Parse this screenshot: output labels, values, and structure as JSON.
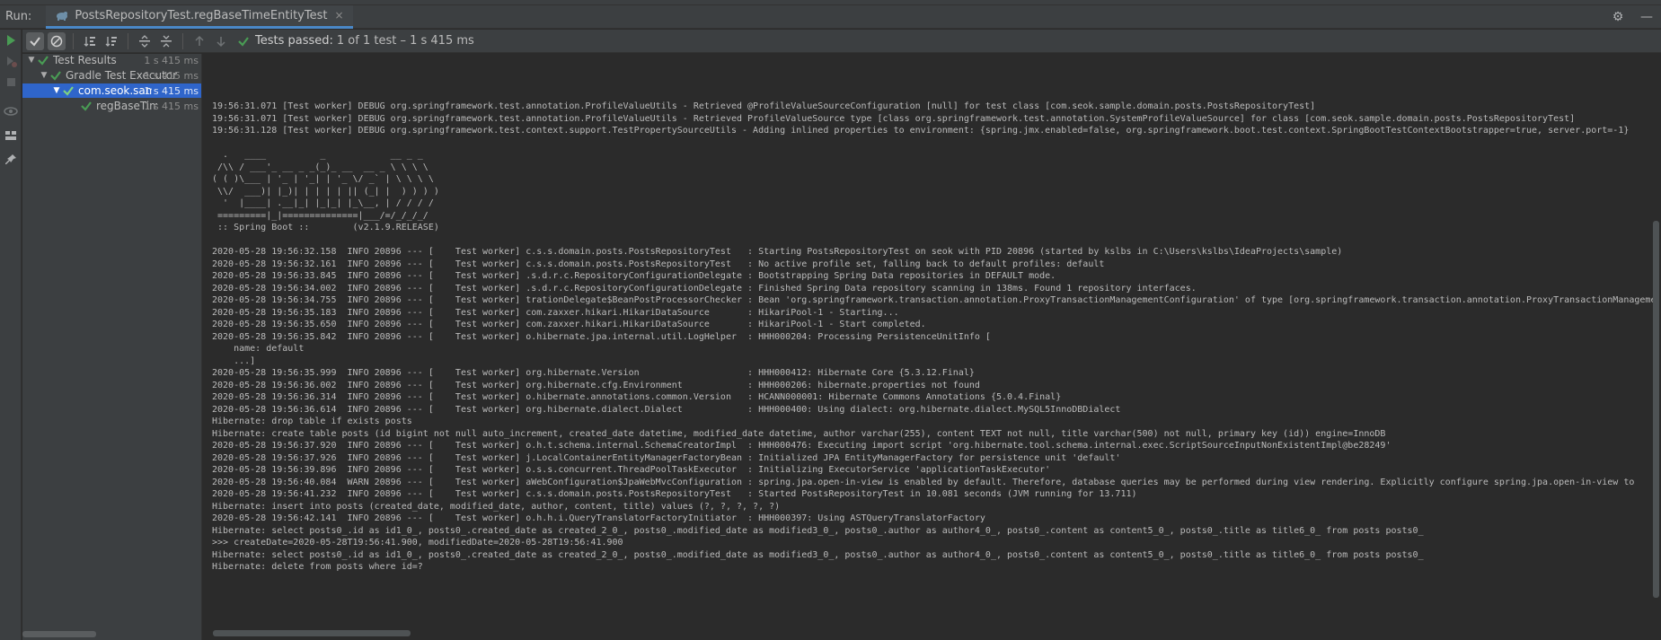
{
  "header": {
    "run_label": "Run:",
    "tab_title": "PostsRepositoryTest.regBaseTimeEntityTest",
    "close_glyph": "×",
    "settings_glyph": "⚙",
    "minimize_glyph": "—"
  },
  "toolbar": {
    "status_label": "Tests passed:",
    "status_summary": "1 of 1 test – 1 s 415 ms"
  },
  "tree": [
    {
      "label": "Test Results",
      "time": "1 s 415 ms"
    },
    {
      "label": "Gradle Test Executor",
      "time": "1 s 415 ms"
    },
    {
      "label": "com.seok.sample.",
      "time": "1 s 415 ms"
    },
    {
      "label": "regBaseTimeEn",
      "time": "1 s 415 ms"
    }
  ],
  "console": {
    "lines": [
      "19:56:31.071 [Test worker] DEBUG org.springframework.test.annotation.ProfileValueUtils - Retrieved @ProfileValueSourceConfiguration [null] for test class [com.seok.sample.domain.posts.PostsRepositoryTest]",
      "19:56:31.071 [Test worker] DEBUG org.springframework.test.annotation.ProfileValueUtils - Retrieved ProfileValueSource type [class org.springframework.test.annotation.SystemProfileValueSource] for class [com.seok.sample.domain.posts.PostsRepositoryTest]",
      "19:56:31.128 [Test worker] DEBUG org.springframework.test.context.support.TestPropertySourceUtils - Adding inlined properties to environment: {spring.jmx.enabled=false, org.springframework.boot.test.context.SpringBootTestContextBootstrapper=true, server.port=-1}",
      "",
      "  .   ____          _            __ _ _",
      " /\\\\ / ___'_ __ _ _(_)_ __  __ _ \\ \\ \\ \\",
      "( ( )\\___ | '_ | '_| | '_ \\/ _` | \\ \\ \\ \\",
      " \\\\/  ___)| |_)| | | | | || (_| |  ) ) ) )",
      "  '  |____| .__|_| |_|_| |_\\__, | / / / /",
      " =========|_|==============|___/=/_/_/_/",
      " :: Spring Boot ::        (v2.1.9.RELEASE)",
      "",
      "2020-05-28 19:56:32.158  INFO 20896 --- [    Test worker] c.s.s.domain.posts.PostsRepositoryTest   : Starting PostsRepositoryTest on seok with PID 20896 (started by kslbs in C:\\Users\\kslbs\\IdeaProjects\\sample)",
      "2020-05-28 19:56:32.161  INFO 20896 --- [    Test worker] c.s.s.domain.posts.PostsRepositoryTest   : No active profile set, falling back to default profiles: default",
      "2020-05-28 19:56:33.845  INFO 20896 --- [    Test worker] .s.d.r.c.RepositoryConfigurationDelegate : Bootstrapping Spring Data repositories in DEFAULT mode.",
      "2020-05-28 19:56:34.002  INFO 20896 --- [    Test worker] .s.d.r.c.RepositoryConfigurationDelegate : Finished Spring Data repository scanning in 138ms. Found 1 repository interfaces.",
      "2020-05-28 19:56:34.755  INFO 20896 --- [    Test worker] trationDelegate$BeanPostProcessorChecker : Bean 'org.springframework.transaction.annotation.ProxyTransactionManagementConfiguration' of type [org.springframework.transaction.annotation.ProxyTransactionManagementConfiguration",
      "2020-05-28 19:56:35.183  INFO 20896 --- [    Test worker] com.zaxxer.hikari.HikariDataSource       : HikariPool-1 - Starting...",
      "2020-05-28 19:56:35.650  INFO 20896 --- [    Test worker] com.zaxxer.hikari.HikariDataSource       : HikariPool-1 - Start completed.",
      "2020-05-28 19:56:35.842  INFO 20896 --- [    Test worker] o.hibernate.jpa.internal.util.LogHelper  : HHH000204: Processing PersistenceUnitInfo [",
      "    name: default",
      "    ...]",
      "2020-05-28 19:56:35.999  INFO 20896 --- [    Test worker] org.hibernate.Version                    : HHH000412: Hibernate Core {5.3.12.Final}",
      "2020-05-28 19:56:36.002  INFO 20896 --- [    Test worker] org.hibernate.cfg.Environment            : HHH000206: hibernate.properties not found",
      "2020-05-28 19:56:36.314  INFO 20896 --- [    Test worker] o.hibernate.annotations.common.Version   : HCANN000001: Hibernate Commons Annotations {5.0.4.Final}",
      "2020-05-28 19:56:36.614  INFO 20896 --- [    Test worker] org.hibernate.dialect.Dialect            : HHH000400: Using dialect: org.hibernate.dialect.MySQL5InnoDBDialect",
      "Hibernate: drop table if exists posts",
      "Hibernate: create table posts (id bigint not null auto_increment, created_date datetime, modified_date datetime, author varchar(255), content TEXT not null, title varchar(500) not null, primary key (id)) engine=InnoDB",
      "2020-05-28 19:56:37.920  INFO 20896 --- [    Test worker] o.h.t.schema.internal.SchemaCreatorImpl  : HHH000476: Executing import script 'org.hibernate.tool.schema.internal.exec.ScriptSourceInputNonExistentImpl@be28249'",
      "2020-05-28 19:56:37.926  INFO 20896 --- [    Test worker] j.LocalContainerEntityManagerFactoryBean : Initialized JPA EntityManagerFactory for persistence unit 'default'",
      "2020-05-28 19:56:39.896  INFO 20896 --- [    Test worker] o.s.s.concurrent.ThreadPoolTaskExecutor  : Initializing ExecutorService 'applicationTaskExecutor'",
      "2020-05-28 19:56:40.084  WARN 20896 --- [    Test worker] aWebConfiguration$JpaWebMvcConfiguration : spring.jpa.open-in-view is enabled by default. Therefore, database queries may be performed during view rendering. Explicitly configure spring.jpa.open-in-view to",
      "2020-05-28 19:56:41.232  INFO 20896 --- [    Test worker] c.s.s.domain.posts.PostsRepositoryTest   : Started PostsRepositoryTest in 10.081 seconds (JVM running for 13.711)",
      "Hibernate: insert into posts (created_date, modified_date, author, content, title) values (?, ?, ?, ?, ?)",
      "2020-05-28 19:56:42.141  INFO 20896 --- [    Test worker] o.h.h.i.QueryTranslatorFactoryInitiator  : HHH000397: Using ASTQueryTranslatorFactory",
      "Hibernate: select posts0_.id as id1_0_, posts0_.created_date as created_2_0_, posts0_.modified_date as modified3_0_, posts0_.author as author4_0_, posts0_.content as content5_0_, posts0_.title as title6_0_ from posts posts0_",
      ">>> createDate=2020-05-28T19:56:41.900, modifiedDate=2020-05-28T19:56:41.900",
      "Hibernate: select posts0_.id as id1_0_, posts0_.created_date as created_2_0_, posts0_.modified_date as modified3_0_, posts0_.author as author4_0_, posts0_.content as content5_0_, posts0_.title as title6_0_ from posts posts0_",
      "Hibernate: delete from posts where id=?"
    ]
  },
  "colors": {
    "pass_green": "#499c54",
    "selection_blue": "#2f65ca",
    "panel_bg": "#3c3f41",
    "console_bg": "#2b2b2b"
  },
  "icons": {
    "left_tools": [
      "run-icon",
      "rerun-failed-icon",
      "stop-icon",
      "view-icon",
      "layout-icon",
      "pin-icon"
    ],
    "toolbar": [
      "show-passed-icon",
      "show-ignored-icon",
      "sort-alpha-icon",
      "sort-duration-icon",
      "expand-all-icon",
      "collapse-all-icon",
      "previous-icon",
      "next-icon"
    ]
  }
}
